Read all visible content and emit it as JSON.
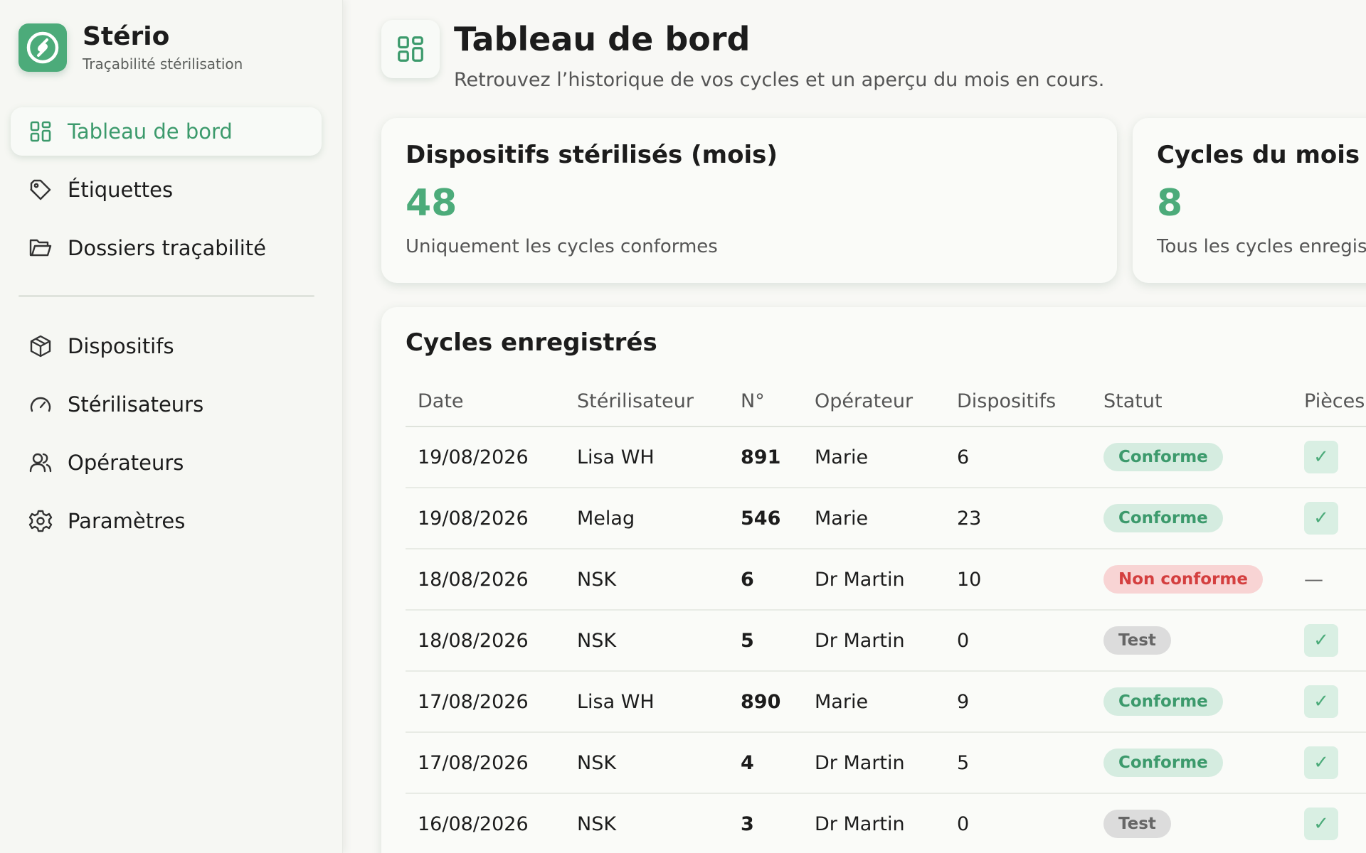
{
  "brand": {
    "name": "Stério",
    "subtitle": "Traçabilité stérilisation"
  },
  "nav": {
    "primary": [
      {
        "label": "Tableau de bord",
        "icon": "grid-icon",
        "active": true
      },
      {
        "label": "Étiquettes",
        "icon": "tag-icon"
      },
      {
        "label": "Dossiers traçabilité",
        "icon": "folder-icon"
      }
    ],
    "secondary": [
      {
        "label": "Dispositifs",
        "icon": "box-icon"
      },
      {
        "label": "Stérilisateurs",
        "icon": "gauge-icon"
      },
      {
        "label": "Opérateurs",
        "icon": "users-icon"
      },
      {
        "label": "Paramètres",
        "icon": "gear-icon"
      }
    ]
  },
  "header": {
    "title": "Tableau de bord",
    "subtitle": "Retrouvez l’historique de vos cycles et un aperçu du mois en cours."
  },
  "stats": [
    {
      "label": "Dispositifs stérilisés (mois)",
      "value": "48",
      "desc": "Uniquement les cycles conformes"
    },
    {
      "label": "Cycles du mois",
      "value": "8",
      "desc": "Tous les cycles enregistrés"
    }
  ],
  "table": {
    "title": "Cycles enregistrés",
    "columns": [
      "Date",
      "Stérilisateur",
      "N°",
      "Opérateur",
      "Dispositifs",
      "Statut",
      "Pièces"
    ],
    "rows": [
      {
        "date": "19/08/2026",
        "sterilizer": "Lisa WH",
        "number": "891",
        "operator": "Marie",
        "devices": "6",
        "status": "Conforme",
        "status_kind": "ok",
        "pieces": "check"
      },
      {
        "date": "19/08/2026",
        "sterilizer": "Melag",
        "number": "546",
        "operator": "Marie",
        "devices": "23",
        "status": "Conforme",
        "status_kind": "ok",
        "pieces": "check"
      },
      {
        "date": "18/08/2026",
        "sterilizer": "NSK",
        "number": "6",
        "operator": "Dr Martin",
        "devices": "10",
        "status": "Non conforme",
        "status_kind": "nok",
        "pieces": "—"
      },
      {
        "date": "18/08/2026",
        "sterilizer": "NSK",
        "number": "5",
        "operator": "Dr Martin",
        "devices": "0",
        "status": "Test",
        "status_kind": "test",
        "pieces": "check"
      },
      {
        "date": "17/08/2026",
        "sterilizer": "Lisa WH",
        "number": "890",
        "operator": "Marie",
        "devices": "9",
        "status": "Conforme",
        "status_kind": "ok",
        "pieces": "check"
      },
      {
        "date": "17/08/2026",
        "sterilizer": "NSK",
        "number": "4",
        "operator": "Dr Martin",
        "devices": "5",
        "status": "Conforme",
        "status_kind": "ok",
        "pieces": "check"
      },
      {
        "date": "16/08/2026",
        "sterilizer": "NSK",
        "number": "3",
        "operator": "Dr Martin",
        "devices": "0",
        "status": "Test",
        "status_kind": "test",
        "pieces": "check"
      }
    ]
  },
  "colors": {
    "accent": "#4cab7a",
    "danger": "#d43f3f",
    "background": "#f8f8f5"
  }
}
